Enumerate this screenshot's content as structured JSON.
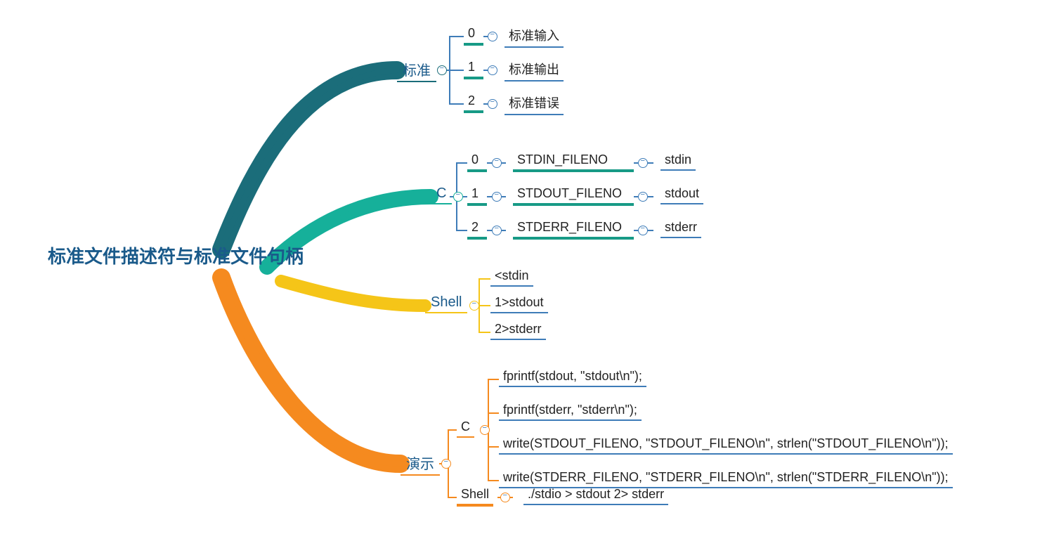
{
  "root": {
    "title": "标准文件描述符与标准文件句柄"
  },
  "branches": {
    "standard": {
      "label": "标准",
      "items": [
        {
          "num": "0",
          "name": "标准输入"
        },
        {
          "num": "1",
          "name": "标准输出"
        },
        {
          "num": "2",
          "name": "标准错误"
        }
      ]
    },
    "c": {
      "label": "C",
      "items": [
        {
          "num": "0",
          "macro": "STDIN_FILENO",
          "stream": "stdin"
        },
        {
          "num": "1",
          "macro": "STDOUT_FILENO",
          "stream": "stdout"
        },
        {
          "num": "2",
          "macro": "STDERR_FILENO",
          "stream": "stderr"
        }
      ]
    },
    "shell": {
      "label": "Shell",
      "items": [
        {
          "text": "<stdin"
        },
        {
          "text": "1>stdout"
        },
        {
          "text": "2>stderr"
        }
      ]
    },
    "demo": {
      "label": "演示",
      "c": {
        "label": "C",
        "lines": [
          "fprintf(stdout, \"stdout\\n\");",
          "fprintf(stderr, \"stderr\\n\");",
          "write(STDOUT_FILENO, \"STDOUT_FILENO\\n\", strlen(\"STDOUT_FILENO\\n\"));",
          "write(STDERR_FILENO, \"STDERR_FILENO\\n\", strlen(\"STDERR_FILENO\\n\"));"
        ]
      },
      "shell": {
        "label": "Shell",
        "cmd": "./stdio > stdout 2> stderr"
      }
    }
  },
  "colors": {
    "teal": "#1b6d7a",
    "green": "#16b09a",
    "yellow": "#f5c518",
    "orange": "#f58a1f",
    "blue": "#3e7cb8"
  }
}
